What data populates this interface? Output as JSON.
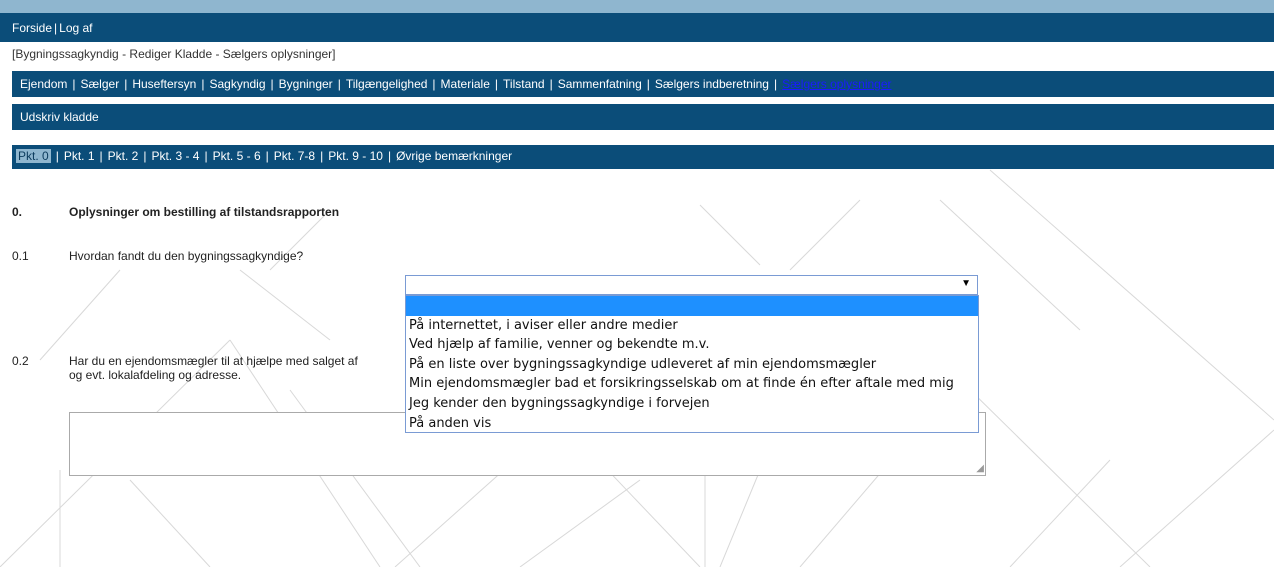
{
  "topbar": {
    "home": "Forside",
    "logout": "Log af"
  },
  "breadcrumb": "[Bygningssagkyndig - Rediger Kladde - Sælgers oplysninger]",
  "main_nav": [
    "Ejendom",
    "Sælger",
    "Huseftersyn",
    "Sagkyndig",
    "Bygninger",
    "Tilgængelighed",
    "Materiale",
    "Tilstand",
    "Sammenfatning",
    "Sælgers indberetning",
    "Sælgers oplysninger"
  ],
  "print_draft": "Udskriv kladde",
  "pkt_nav": [
    "Pkt. 0",
    "Pkt. 1",
    "Pkt. 2",
    "Pkt. 3 - 4",
    "Pkt. 5 - 6",
    "Pkt. 7-8",
    "Pkt. 9 - 10",
    "Øvrige bemærkninger"
  ],
  "section": {
    "number": "0.",
    "title": "Oplysninger om bestilling af tilstandsrapporten"
  },
  "q1": {
    "number": "0.1",
    "text": "Hvordan fandt du den bygningssagkyndige?",
    "selected": ""
  },
  "q2": {
    "number": "0.2",
    "line1": "Har du en ejendomsmægler til at hjælpe med salget af",
    "line2": "og evt. lokalafdeling og adresse.",
    "value": ""
  },
  "dropdown_options": [
    "",
    "På internettet, i aviser eller andre medier",
    "Ved hjælp af familie, venner og bekendte m.v.",
    "På en liste over bygningssagkyndige udleveret af min ejendomsmægler",
    "Min ejendomsmægler bad et forsikringsselskab om at finde én efter aftale med mig",
    "Jeg kender den bygningssagkyndige i forvejen",
    "På anden vis"
  ],
  "colors": {
    "nav_bar": "#0b4d79",
    "top_strip": "#8fb6cf",
    "highlight": "#1e90ff"
  }
}
